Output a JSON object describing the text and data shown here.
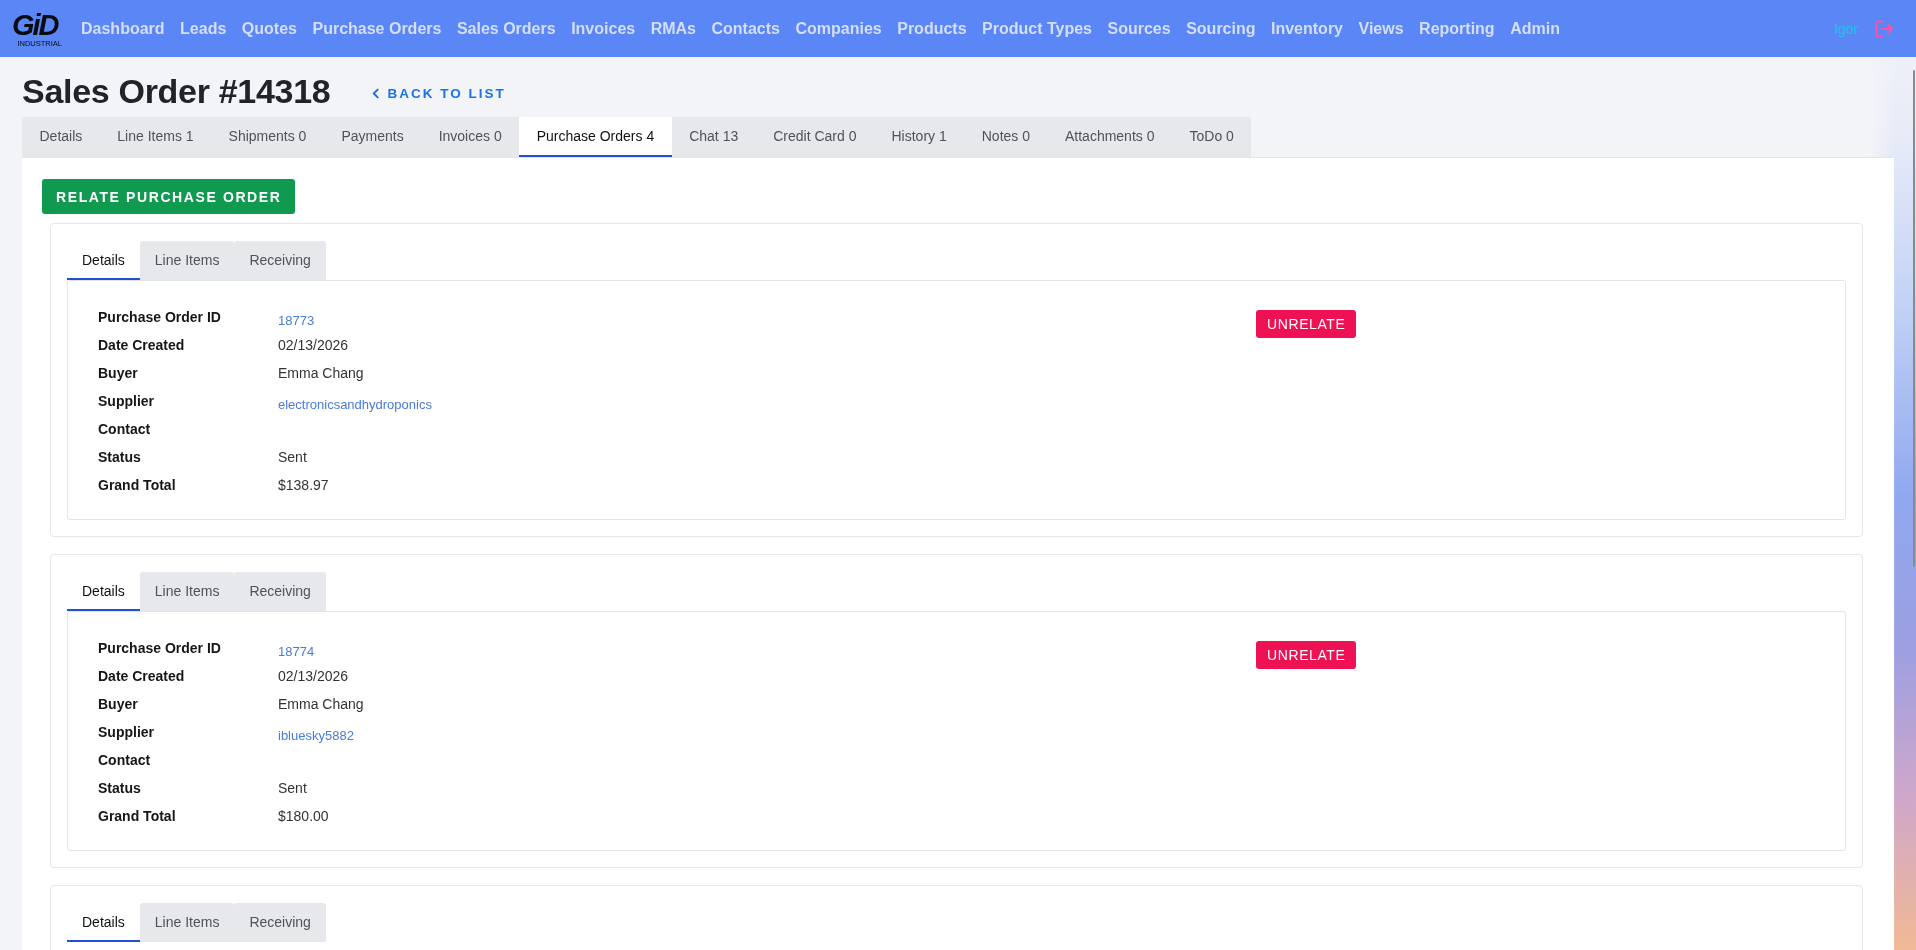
{
  "nav": {
    "logo": {
      "text": "GiD",
      "subtitle": "INDUSTRIAL"
    },
    "items": [
      "Dashboard",
      "Leads",
      "Quotes",
      "Purchase Orders",
      "Sales Orders",
      "Invoices",
      "RMAs",
      "Contacts",
      "Companies",
      "Products",
      "Product Types",
      "Sources",
      "Sourcing",
      "Inventory",
      "Views",
      "Reporting",
      "Admin"
    ],
    "user": "Igor"
  },
  "header": {
    "title": "Sales Order #14318",
    "back_link": "BACK TO LIST"
  },
  "tabs": [
    {
      "label": "Details",
      "selected": false
    },
    {
      "label": "Line Items 1",
      "selected": false
    },
    {
      "label": "Shipments 0",
      "selected": false
    },
    {
      "label": "Payments",
      "selected": false
    },
    {
      "label": "Invoices 0",
      "selected": false
    },
    {
      "label": "Purchase Orders 4",
      "selected": true
    },
    {
      "label": "Chat 13",
      "selected": false
    },
    {
      "label": "Credit Card 0",
      "selected": false
    },
    {
      "label": "History 1",
      "selected": false
    },
    {
      "label": "Notes 0",
      "selected": false
    },
    {
      "label": "Attachments 0",
      "selected": false
    },
    {
      "label": "ToDo 0",
      "selected": false
    }
  ],
  "relate_button": "RELATE PURCHASE ORDER",
  "purchase_orders": [
    {
      "tabs": [
        {
          "label": "Details",
          "selected": true
        },
        {
          "label": "Line Items",
          "selected": false
        },
        {
          "label": "Receiving",
          "selected": false
        }
      ],
      "fields": [
        {
          "label": "Purchase Order ID",
          "value": "18773",
          "kind": "link"
        },
        {
          "label": "Date Created",
          "value": "02/13/2026",
          "kind": "text"
        },
        {
          "label": "Buyer",
          "value": "Emma Chang",
          "kind": "text"
        },
        {
          "label": "Supplier",
          "value": "electronicsandhydroponics",
          "kind": "link"
        },
        {
          "label": "Contact"
        },
        {
          "label": "Status",
          "value": "Sent",
          "kind": "text"
        },
        {
          "label": "Grand Total",
          "value": "$138.97",
          "kind": "text"
        }
      ],
      "unrelate_button": "UNRELATE"
    },
    {
      "tabs": [
        {
          "label": "Details",
          "selected": true
        },
        {
          "label": "Line Items",
          "selected": false
        },
        {
          "label": "Receiving",
          "selected": false
        }
      ],
      "fields": [
        {
          "label": "Purchase Order ID",
          "value": "18774",
          "kind": "link"
        },
        {
          "label": "Date Created",
          "value": "02/13/2026",
          "kind": "text"
        },
        {
          "label": "Buyer",
          "value": "Emma Chang",
          "kind": "text"
        },
        {
          "label": "Supplier",
          "value": "ibluesky5882",
          "kind": "link"
        },
        {
          "label": "Contact"
        },
        {
          "label": "Status",
          "value": "Sent",
          "kind": "text"
        },
        {
          "label": "Grand Total",
          "value": "$180.00",
          "kind": "text"
        }
      ],
      "unrelate_button": "UNRELATE"
    },
    {
      "tabs": [
        {
          "label": "Details",
          "selected": true
        },
        {
          "label": "Line Items",
          "selected": false
        },
        {
          "label": "Receiving",
          "selected": false
        }
      ]
    }
  ]
}
